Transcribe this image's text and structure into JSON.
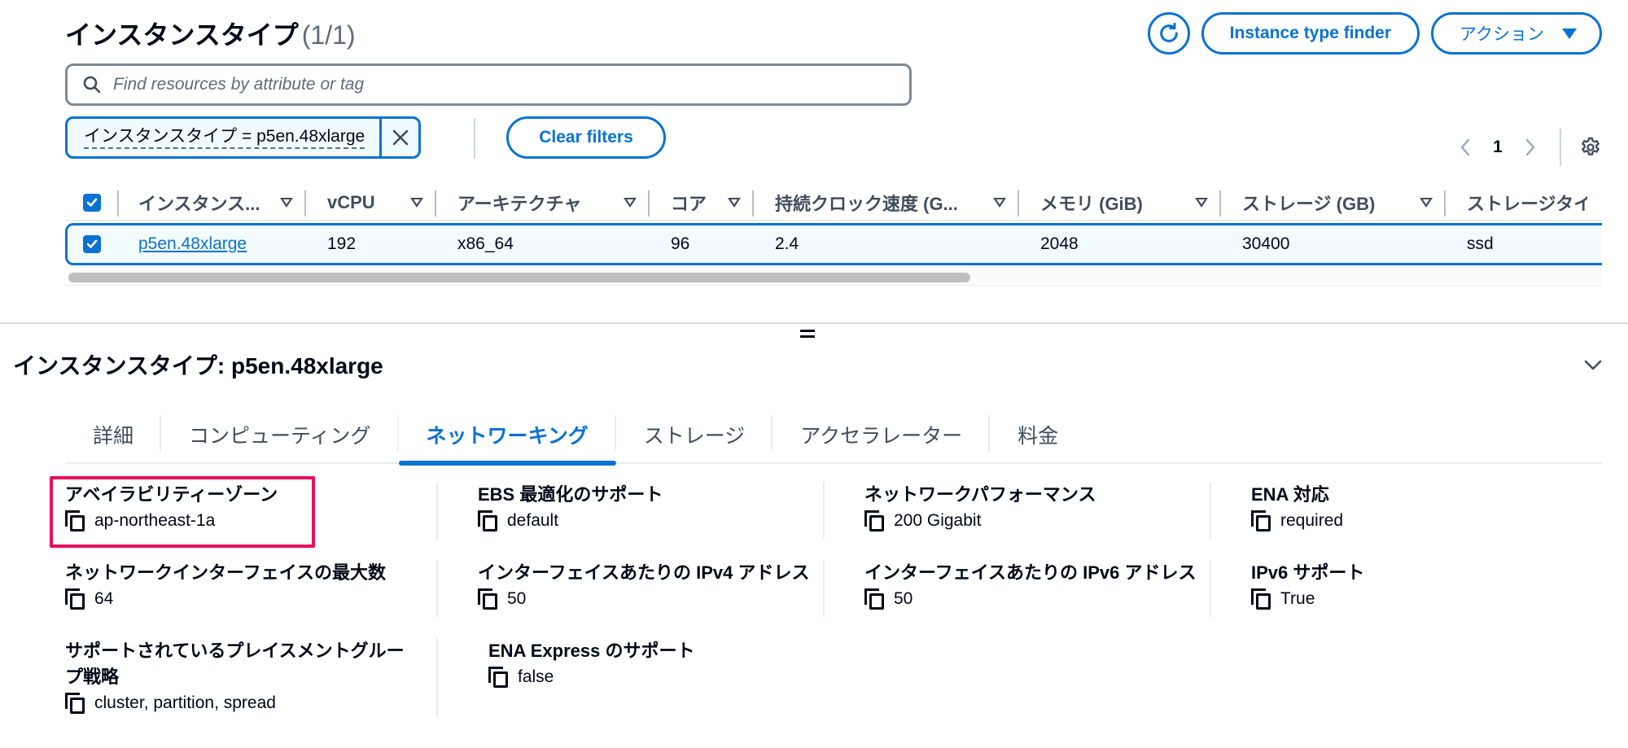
{
  "header": {
    "title": "インスタンスタイプ",
    "count": "(1/1)",
    "refresh_icon": "refresh-icon",
    "finder_button": "Instance type finder",
    "actions_button": "アクション"
  },
  "search": {
    "placeholder": "Find resources by attribute or tag",
    "value": ""
  },
  "filter": {
    "token": "インスタンスタイプ = p5en.48xlarge",
    "clear_label": "Clear filters"
  },
  "pagination": {
    "current_page": "1"
  },
  "table": {
    "columns": [
      "インスタンス...",
      "vCPU",
      "アーキテクチャ",
      "コア",
      "持続クロック速度 (G...",
      "メモリ (GiB)",
      "ストレージ (GB)",
      "ストレージタイ"
    ],
    "rows": [
      {
        "selected": true,
        "instance_type": "p5en.48xlarge",
        "vcpu": "192",
        "architecture": "x86_64",
        "cores": "96",
        "clock_speed": "2.4",
        "memory": "2048",
        "storage": "30400",
        "storage_type": "ssd"
      }
    ],
    "scroll_position_fraction": 0
  },
  "detail": {
    "title": "インスタンスタイプ: p5en.48xlarge",
    "tabs": [
      {
        "label": "詳細",
        "active": false
      },
      {
        "label": "コンピューティング",
        "active": false
      },
      {
        "label": "ネットワーキング",
        "active": true
      },
      {
        "label": "ストレージ",
        "active": false
      },
      {
        "label": "アクセラレーター",
        "active": false
      },
      {
        "label": "料金",
        "active": false
      }
    ],
    "fields": [
      {
        "label": "アベイラビリティーゾーン",
        "value": "ap-northeast-1a",
        "highlighted": true
      },
      {
        "label": "EBS 最適化のサポート",
        "value": "default"
      },
      {
        "label": "ネットワークパフォーマンス",
        "value": "200 Gigabit"
      },
      {
        "label": "ENA 対応",
        "value": "required"
      },
      {
        "label": "ネットワークインターフェイスの最大数",
        "value": "64"
      },
      {
        "label": "インターフェイスあたりの IPv4 アドレス",
        "value": "50"
      },
      {
        "label": "インターフェイスあたりの IPv6 アドレス",
        "value": "50"
      },
      {
        "label": "IPv6 サポート",
        "value": "True"
      },
      {
        "label": "サポートされているプレイスメントグループ戦略",
        "value": "cluster, partition, spread"
      },
      {
        "label": "ENA Express のサポート",
        "value": "false"
      }
    ]
  },
  "colors": {
    "accent": "#0972d3",
    "highlight": "#ec0d5d",
    "selected_row_bg": "#f2fbff",
    "text": "#000716"
  }
}
